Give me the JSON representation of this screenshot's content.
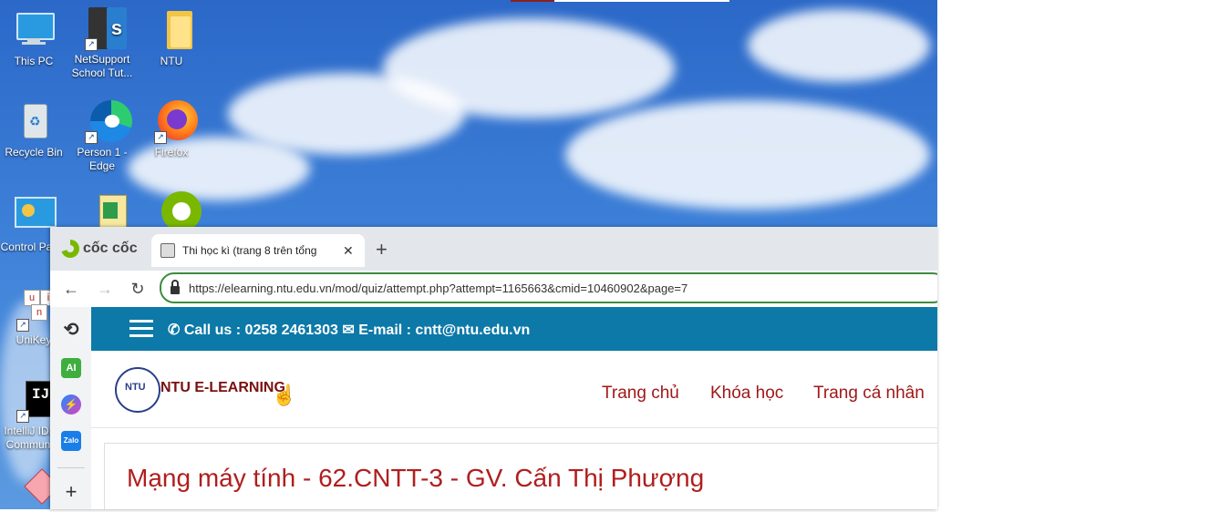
{
  "desktop": {
    "icons": [
      {
        "label": "This PC",
        "icon": "this-pc-icon"
      },
      {
        "label": "NetSupport School Tut...",
        "icon": "netsupport-icon"
      },
      {
        "label": "NTU",
        "icon": "folder-icon"
      },
      {
        "label": "Recycle Bin",
        "icon": "recycle-bin-icon"
      },
      {
        "label": "Person 1 - Edge",
        "icon": "edge-icon"
      },
      {
        "label": "Firefox",
        "icon": "firefox-icon"
      },
      {
        "label": "Control Panel",
        "icon": "control-panel-icon"
      },
      {
        "label": "UniKey",
        "icon": "unikey-icon"
      },
      {
        "label": "IntelliJ IDEA Community",
        "icon": "intellij-icon"
      }
    ]
  },
  "browser": {
    "brand": "cốc cốc",
    "tab": {
      "title": "Thi học kì (trang 8 trên tổng"
    },
    "url": "https://elearning.ntu.edu.vn/mod/quiz/attempt.php?attempt=1165663&cmid=10460902&page=7"
  },
  "sidebar": {
    "ai_label": "AI",
    "zalo_label": "Zalo"
  },
  "site": {
    "phone": "Call us : 0258 2461303",
    "email": "E-mail : cntt@ntu.edu.vn",
    "logo_mark": "NTU",
    "logo_text": "NTU E-LEARNING",
    "nav": [
      "Trang chủ",
      "Khóa học",
      "Trang cá nhân"
    ],
    "course_title": "Mạng máy tính - 62.CNTT-3 - GV. Cấn Thị Phượng"
  },
  "colors": {
    "topbar": "#0c79a8",
    "nav_link": "#a01818",
    "course_title": "#b01e1e",
    "omnibox_border": "#3d8b3d"
  }
}
